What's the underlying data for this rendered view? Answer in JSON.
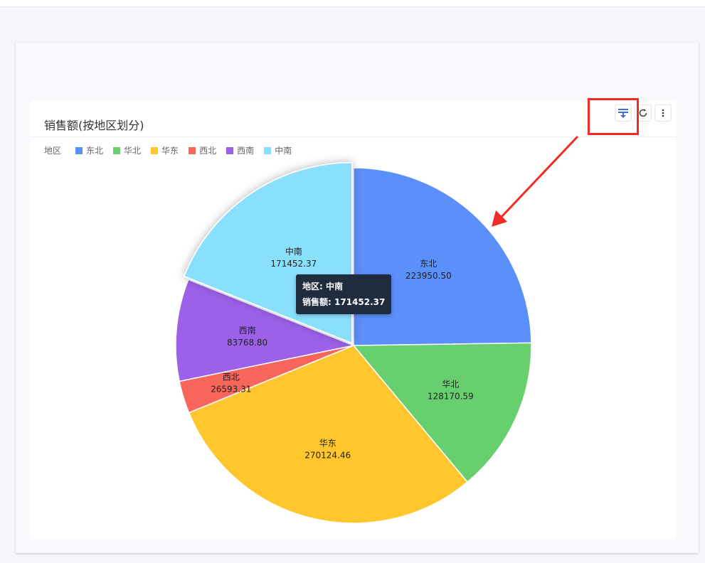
{
  "chart_title": "销售额(按地区划分)",
  "legend": {
    "title": "地区"
  },
  "tooltip": {
    "line1": "地区: 中南",
    "line2": "销售额: 171452.37"
  },
  "toolbar": {
    "icons": [
      "export-data-icon",
      "refresh-icon",
      "more-vertical-icon"
    ]
  },
  "colors": {
    "东北": "#5b8ff9",
    "华北": "#68cf6e",
    "华东": "#ffc72d",
    "西北": "#f7655b",
    "西南": "#9d60e8",
    "中南": "#89e0fd",
    "annotation": "#f02b24"
  },
  "chart_data": {
    "type": "pie",
    "title": "销售额(按地区划分)",
    "legend_title": "地区",
    "legend_position": "top-left",
    "categories": [
      "东北",
      "华北",
      "华东",
      "西北",
      "西南",
      "中南"
    ],
    "values": [
      223950.5,
      128170.59,
      270124.46,
      26593.31,
      83768.8,
      171452.37
    ],
    "value_labels": [
      "223950.50",
      "128170.59",
      "270124.46",
      "26593.31",
      "83768.80",
      "171452.37"
    ],
    "highlighted": "中南"
  }
}
